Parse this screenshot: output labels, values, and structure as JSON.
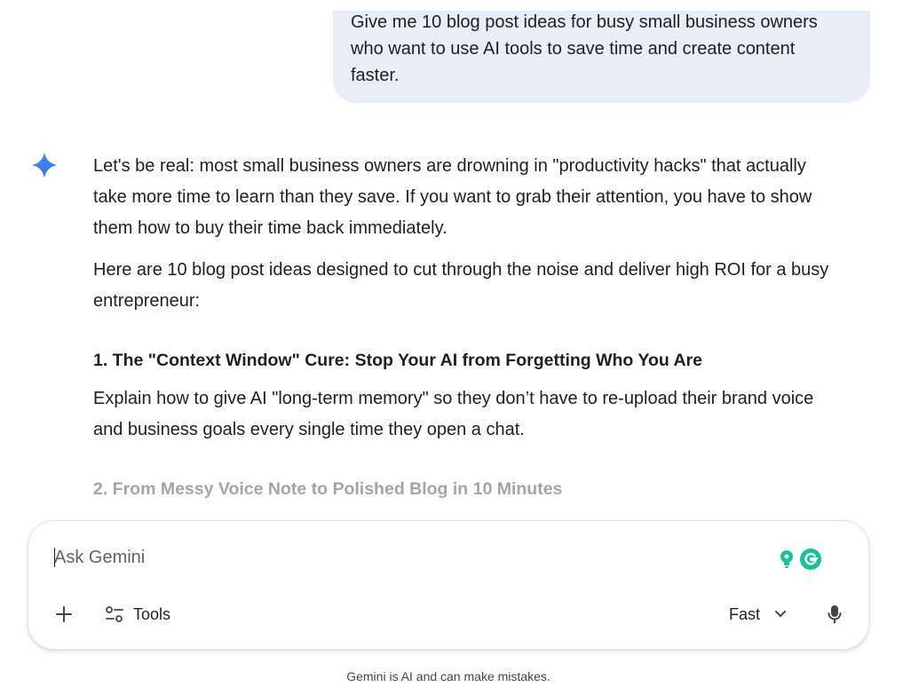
{
  "conversation": {
    "user_message": {
      "lines": [
        "Give me 10 blog post ideas for busy small business owners",
        "who want to use AI tools to save time and create content",
        "faster."
      ]
    },
    "response": {
      "logo_icon": "gemini-sparkle-icon",
      "paragraph_1_lines": [
        "Let's be real: most small business owners are drowning in \"productivity hacks\" that actually",
        "take more time to learn than they save. If you want to grab their attention, you have to show",
        "them how to buy their time back immediately."
      ],
      "paragraph_2_lines": [
        "Here are 10 blog post ideas designed to cut through the noise and deliver high ROI for a busy",
        "entrepreneur:"
      ],
      "idea_1_heading": "1. The \"Context Window\" Cure: Stop Your AI from Forgetting Who You Are",
      "idea_1_body_lines": [
        "Explain how to give AI \"long-term memory\" so they don’t have to re-upload their brand voice",
        "and business goals every single time they open a chat."
      ],
      "idea_2_heading": "2. From Messy Voice Note to Polished Blog in 10 Minutes"
    }
  },
  "composer": {
    "placeholder": "Ask Gemini",
    "value": "",
    "tools_label": "Tools",
    "mode_label": "Fast",
    "icons": {
      "plus": "plus-icon",
      "tools": "tools-sliders-icon",
      "mode_dropdown": "chevron-down-icon",
      "mic": "microphone-icon",
      "extension_1": "lightbulb-icon",
      "extension_2": "grammarly-icon"
    }
  },
  "footer": {
    "disclaimer": "Gemini is AI and can make mistakes."
  },
  "colors": {
    "user_bubble_bg": "#e9eef6",
    "gemini_blue": "#4285f4",
    "grammarly_green": "#15c39a",
    "text_primary": "#1f1f1f",
    "text_faded": "#8a8a8a"
  }
}
